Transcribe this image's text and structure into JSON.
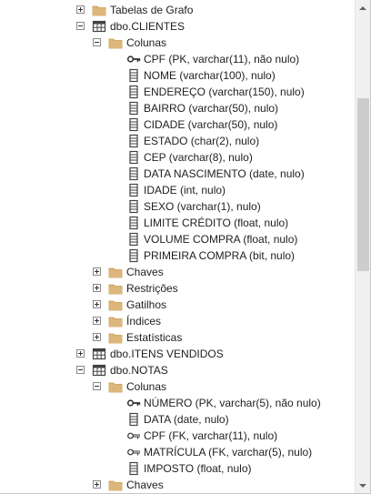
{
  "tree": [
    {
      "type": "expander",
      "state": "plus",
      "level": 0
    },
    {
      "type": "folder",
      "level": 0,
      "label": "Tabelas de Grafo"
    },
    {
      "type": "table",
      "level": 0,
      "label": "dbo.CLIENTES",
      "state": "minus"
    },
    {
      "type": "folder",
      "level": 1,
      "label": "Colunas",
      "state": "minus"
    },
    {
      "type": "key",
      "level": 2,
      "label": "CPF (PK, varchar(11), não nulo)"
    },
    {
      "type": "column",
      "level": 2,
      "label": "NOME (varchar(100), nulo)"
    },
    {
      "type": "column",
      "level": 2,
      "label": "ENDEREÇO (varchar(150), nulo)"
    },
    {
      "type": "column",
      "level": 2,
      "label": "BAIRRO (varchar(50), nulo)"
    },
    {
      "type": "column",
      "level": 2,
      "label": "CIDADE (varchar(50), nulo)"
    },
    {
      "type": "column",
      "level": 2,
      "label": "ESTADO (char(2), nulo)"
    },
    {
      "type": "column",
      "level": 2,
      "label": "CEP (varchar(8), nulo)"
    },
    {
      "type": "column",
      "level": 2,
      "label": "DATA NASCIMENTO (date, nulo)"
    },
    {
      "type": "column",
      "level": 2,
      "label": "IDADE (int, nulo)"
    },
    {
      "type": "column",
      "level": 2,
      "label": "SEXO (varchar(1), nulo)"
    },
    {
      "type": "column",
      "level": 2,
      "label": "LIMITE CRÉDITO (float, nulo)"
    },
    {
      "type": "column",
      "level": 2,
      "label": "VOLUME COMPRA (float, nulo)"
    },
    {
      "type": "column",
      "level": 2,
      "label": "PRIMEIRA COMPRA (bit, nulo)"
    },
    {
      "type": "folder",
      "level": 1,
      "label": "Chaves",
      "state": "plus"
    },
    {
      "type": "folder",
      "level": 1,
      "label": "Restrições",
      "state": "plus"
    },
    {
      "type": "folder",
      "level": 1,
      "label": "Gatilhos",
      "state": "plus"
    },
    {
      "type": "folder",
      "level": 1,
      "label": "Índices",
      "state": "plus"
    },
    {
      "type": "folder",
      "level": 1,
      "label": "Estatísticas",
      "state": "plus"
    },
    {
      "type": "table",
      "level": 0,
      "label": "dbo.ITENS VENDIDOS",
      "state": "plus"
    },
    {
      "type": "table",
      "level": 0,
      "label": "dbo.NOTAS",
      "state": "minus"
    },
    {
      "type": "folder",
      "level": 1,
      "label": "Colunas",
      "state": "minus"
    },
    {
      "type": "key",
      "level": 2,
      "label": "NÚMERO (PK, varchar(5), não nulo)"
    },
    {
      "type": "column",
      "level": 2,
      "label": "DATA (date, nulo)"
    },
    {
      "type": "fk",
      "level": 2,
      "label": "CPF (FK, varchar(11), nulo)"
    },
    {
      "type": "fk",
      "level": 2,
      "label": "MATRÍCULA (FK, varchar(5), nulo)"
    },
    {
      "type": "column",
      "level": 2,
      "label": "IMPOSTO (float, nulo)"
    },
    {
      "type": "folder",
      "level": 1,
      "label": "Chaves",
      "state": "plus"
    }
  ],
  "colors": {
    "folder": "#dcb67a",
    "folder_dark": "#c79a4a",
    "table_border": "#424242",
    "key": "#333333",
    "column": "#424242"
  }
}
